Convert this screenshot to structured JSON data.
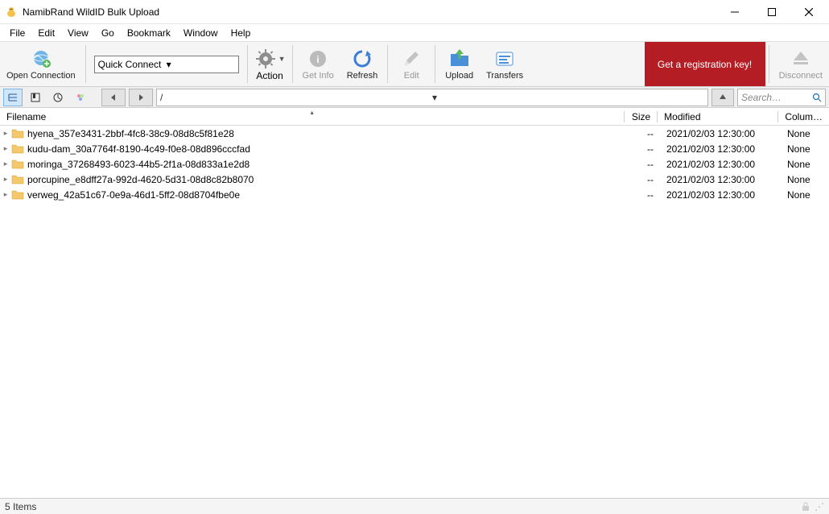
{
  "window": {
    "title": "NamibRand WildID Bulk Upload"
  },
  "menu": {
    "items": [
      "File",
      "Edit",
      "View",
      "Go",
      "Bookmark",
      "Window",
      "Help"
    ]
  },
  "toolbar": {
    "open_connection": "Open Connection",
    "quick_connect": "Quick Connect",
    "action": "Action",
    "get_info": "Get Info",
    "refresh": "Refresh",
    "edit": "Edit",
    "upload": "Upload",
    "transfers": "Transfers",
    "registration": "Get a registration key!",
    "disconnect": "Disconnect"
  },
  "nav": {
    "path": "/",
    "search_placeholder": "Search…"
  },
  "columns": {
    "filename": "Filename",
    "size": "Size",
    "modified": "Modified",
    "column": "Colum…"
  },
  "files": [
    {
      "name": "hyena_357e3431-2bbf-4fc8-38c9-08d8c5f81e28",
      "size": "--",
      "modified": "2021/02/03 12:30:00",
      "column": "None"
    },
    {
      "name": "kudu-dam_30a7764f-8190-4c49-f0e8-08d896cccfad",
      "size": "--",
      "modified": "2021/02/03 12:30:00",
      "column": "None"
    },
    {
      "name": "moringa_37268493-6023-44b5-2f1a-08d833a1e2d8",
      "size": "--",
      "modified": "2021/02/03 12:30:00",
      "column": "None"
    },
    {
      "name": "porcupine_e8dff27a-992d-4620-5d31-08d8c82b8070",
      "size": "--",
      "modified": "2021/02/03 12:30:00",
      "column": "None"
    },
    {
      "name": "verweg_42a51c67-0e9a-46d1-5ff2-08d8704fbe0e",
      "size": "--",
      "modified": "2021/02/03 12:30:00",
      "column": "None"
    }
  ],
  "status": {
    "items_text": "5 Items"
  }
}
